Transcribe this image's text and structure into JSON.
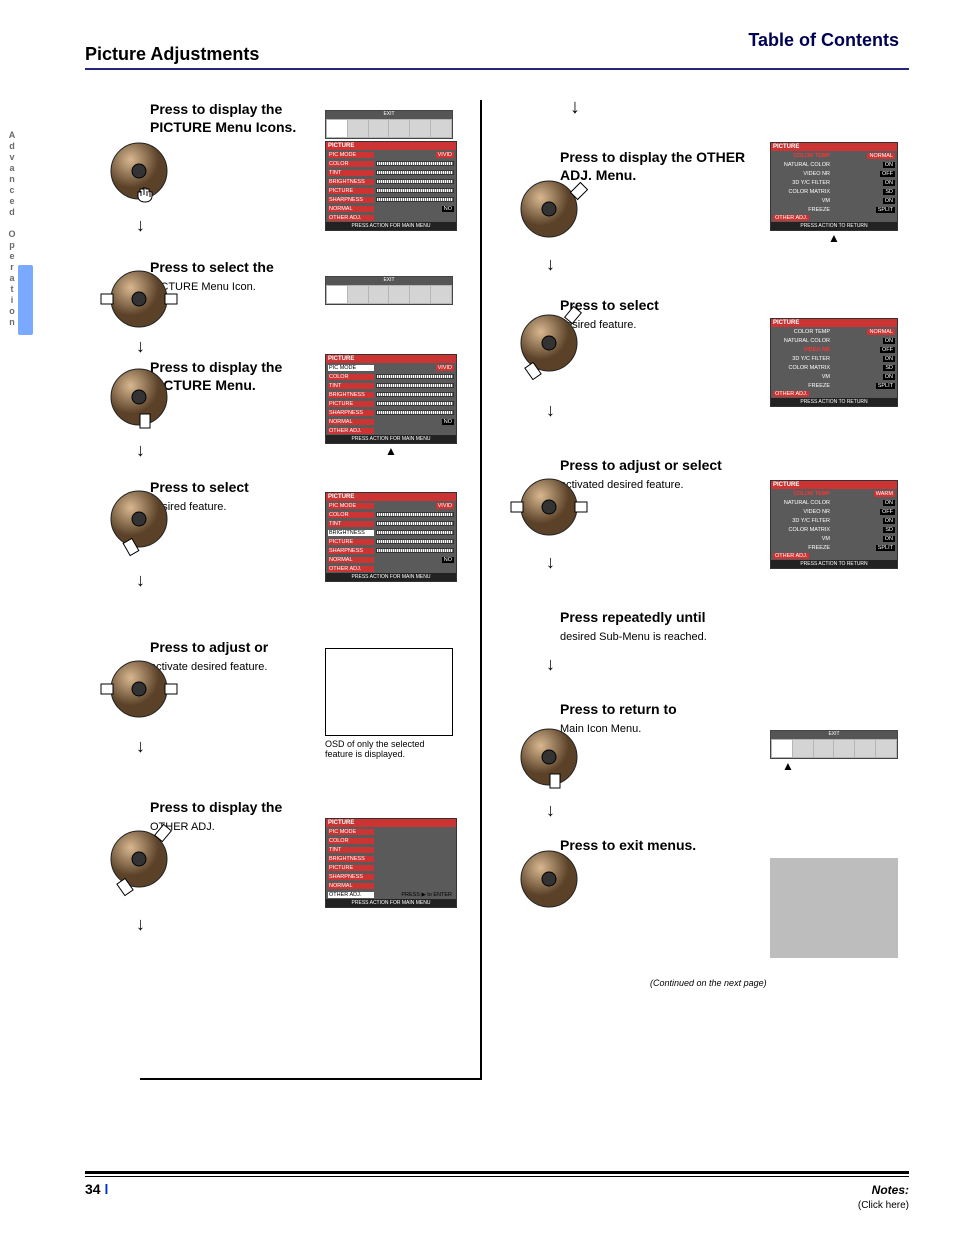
{
  "toc_title": "Table of Contents",
  "section_title": "Picture Adjustments",
  "advanced_vertical": "Advanced Operation",
  "page_number": "34",
  "notes_link": "Notes:",
  "notes_sub": "(Click here)",
  "continued": "(Continued on the next page)",
  "osd_common": {
    "exit": "EXIT",
    "press_main": "PRESS ACTION FOR MAIN MENU",
    "press_return": "PRESS ACTION TO RETURN",
    "picture_hdr": "PICTURE",
    "other_adj": "OTHER ADJ.",
    "press_enter": "PRESS ▶ to ENTER"
  },
  "osd_rows": {
    "pic_mode": "PIC MODE",
    "color": "COLOR",
    "tint": "TINT",
    "brightness": "BRIGHTNESS",
    "picture": "PICTURE",
    "sharpness": "SHARPNESS",
    "normal": "NORMAL",
    "vivid": "VIVID",
    "no": "NO"
  },
  "osd_other": {
    "color_temp": "COLOR TEMP",
    "natural_color": "NATURAL COLOR",
    "video_nr": "VIDEO NR",
    "yc_filter": "3D Y/C FILTER",
    "color_matrix": "COLOR MATRIX",
    "vm": "VM",
    "freeze": "FREEZE",
    "normal_v": "NORMAL",
    "warm_v": "WARM",
    "on": "ON",
    "off": "OFF",
    "sd": "SD",
    "split": "SPLIT"
  },
  "steps_left": [
    {
      "hd": "Press to display the PICTURE Menu Icons.",
      "body": "",
      "fig": "osd_full1"
    },
    {
      "hd": "Press to select the",
      "body": "PICTURE Menu Icon.",
      "fig": "tabbar"
    },
    {
      "hd": "Press to display the PICTURE Menu.",
      "body": "",
      "fig": "osd_full2",
      "uparrow": true
    },
    {
      "hd": "Press to select",
      "body": "desired feature.",
      "fig": "osd_full3"
    },
    {
      "hd": "Press to adjust or",
      "body": "activate desired feature.",
      "fig": "plainbox",
      "plainbox_lines": [
        "OSD of only the selected",
        "feature is displayed."
      ]
    },
    {
      "hd": "Press to display the",
      "body": "OTHER ADJ.",
      "fig": "osd_full4"
    }
  ],
  "steps_right": [
    {
      "hd": "Press to display the OTHER ADJ. Menu.",
      "body": "",
      "fig": "osd_other1",
      "uparrow": true
    },
    {
      "hd": "Press to select",
      "body": "desired feature.",
      "fig": "osd_other2"
    },
    {
      "hd": "Press to adjust or select",
      "body": "activated desired feature.",
      "fig": "osd_other3"
    },
    {
      "hd": "Press repeatedly until",
      "body": "desired Sub-Menu is reached.",
      "fig": null
    },
    {
      "hd": "Press to return to",
      "body": "Main Icon Menu.",
      "fig": "tabbar2",
      "uparrow": true
    },
    {
      "hd": "Press to exit menus.",
      "body": "",
      "fig": "greybox"
    }
  ]
}
